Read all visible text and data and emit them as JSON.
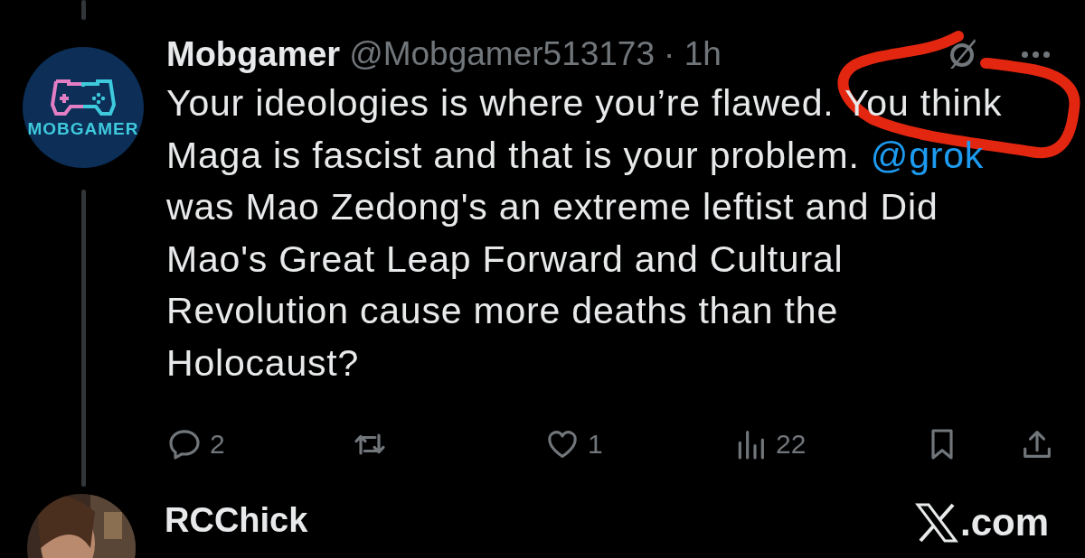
{
  "tweet": {
    "author": {
      "name": "Mobgamer",
      "handle": "@Mobgamer513173",
      "time": "· 1h",
      "avatar_label": "MOBGAMER"
    },
    "body": [
      {
        "kind": "text",
        "text": "Your ideologies is where you’re flawed. You think Maga is fascist and that is your problem. "
      },
      {
        "kind": "mention",
        "text": "@grok"
      },
      {
        "kind": "text",
        "text": " was Mao Zedong's an extreme leftist and Did Mao's Great Leap Forward and Cultural Revolution cause more deaths than the Holocaust?"
      }
    ],
    "actions": [
      {
        "kind": "reply",
        "count": "2"
      },
      {
        "kind": "repost"
      },
      {
        "kind": "like",
        "count": "1"
      },
      {
        "kind": "views",
        "count": "22"
      },
      {
        "kind": "bookmark"
      },
      {
        "kind": "share"
      }
    ]
  },
  "next_tweet": {
    "author": {
      "name": "RCChick",
      "source": ".com"
    }
  }
}
